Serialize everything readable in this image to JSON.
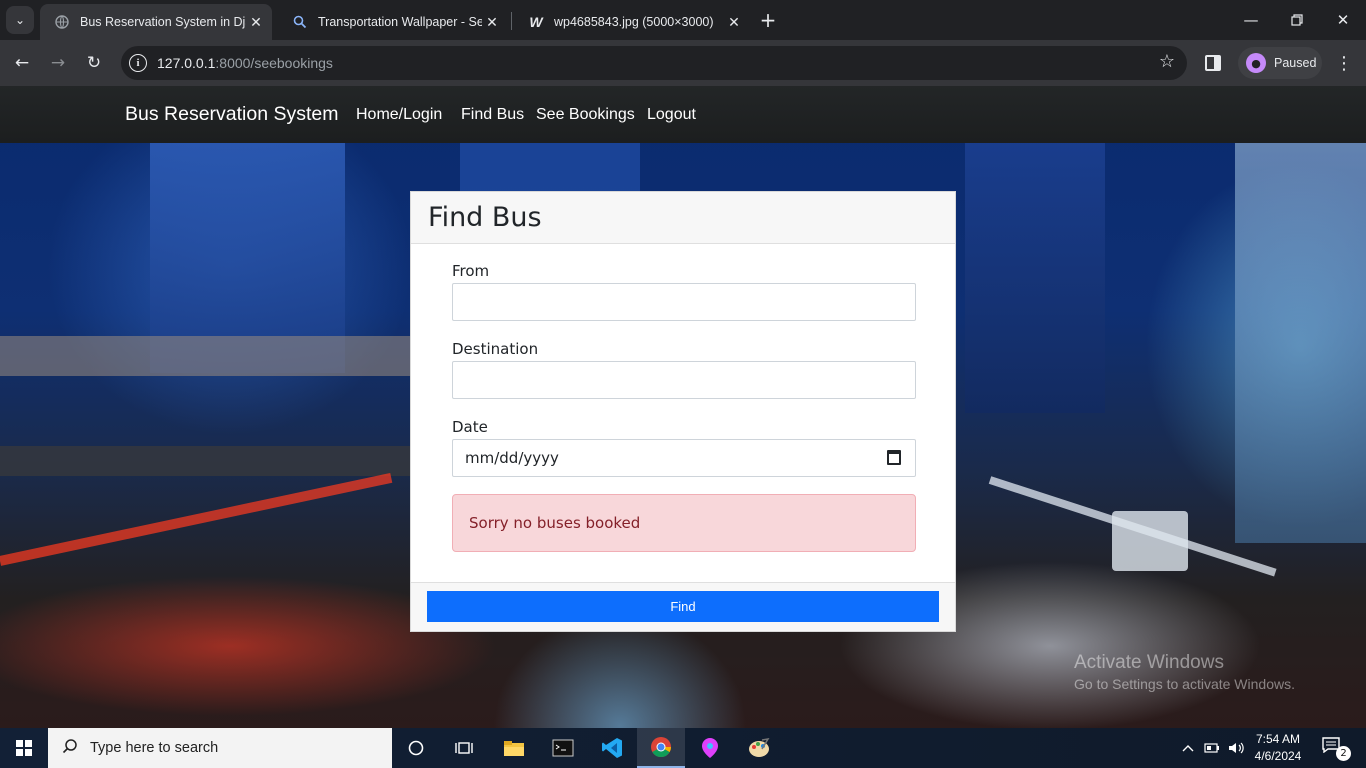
{
  "browser": {
    "tabs": [
      {
        "title": "Bus Reservation System in Djang",
        "active": true
      },
      {
        "title": "Transportation Wallpaper - Sear",
        "active": false
      },
      {
        "title": "wp4685843.jpg (5000×3000)",
        "active": false
      }
    ],
    "address": {
      "host": "127.0.0.1",
      "path": ":8000/seebookings"
    },
    "profile_label": "Paused"
  },
  "site": {
    "brand": "Bus Reservation System",
    "nav": [
      "Home/Login",
      "Find Bus",
      "See Bookings",
      "Logout"
    ]
  },
  "card": {
    "title": "Find Bus",
    "from_label": "From",
    "from_value": "",
    "destination_label": "Destination",
    "destination_value": "",
    "date_label": "Date",
    "date_placeholder": "mm/dd/yyyy",
    "alert_text": "Sorry no buses booked",
    "find_button": "Find"
  },
  "watermark": {
    "line1": "Activate Windows",
    "line2": "Go to Settings to activate Windows."
  },
  "taskbar": {
    "search_placeholder": "Type here to search",
    "time": "7:54 AM",
    "date": "4/6/2024",
    "notification_count": "2"
  },
  "colors": {
    "primary_button": "#0d6efd",
    "alert_bg": "#f8d7da",
    "alert_text": "#842029",
    "navbar_bg": "#212529"
  }
}
